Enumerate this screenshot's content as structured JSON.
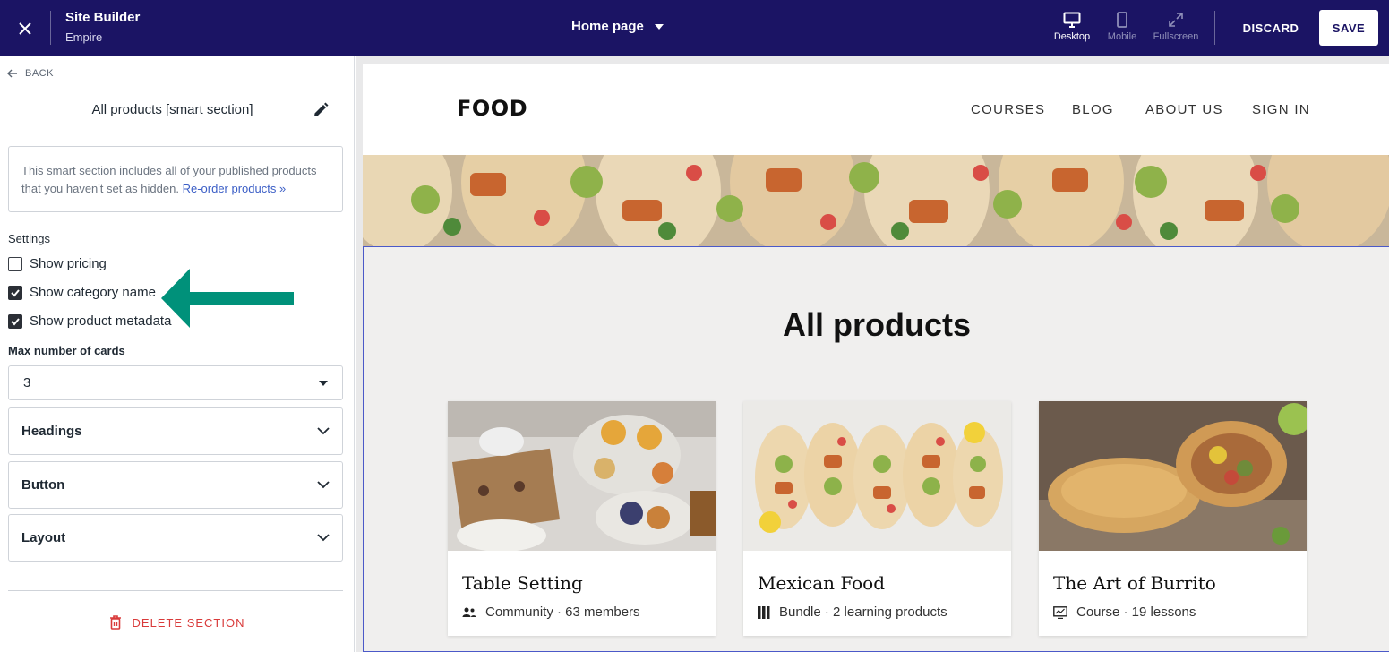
{
  "topbar": {
    "app_title": "Site Builder",
    "app_subtitle": "Empire",
    "page_select": "Home page",
    "views": [
      {
        "label": "Desktop",
        "icon": "desktop-icon",
        "active": true
      },
      {
        "label": "Mobile",
        "icon": "mobile-icon",
        "active": false
      },
      {
        "label": "Fullscreen",
        "icon": "fullscreen-icon",
        "active": false
      }
    ],
    "discard_label": "DISCARD",
    "save_label": "SAVE"
  },
  "sidebar": {
    "back_label": "BACK",
    "section_title": "All products [smart section]",
    "info_text": "This smart section includes all of your published products that you haven't set as hidden.",
    "info_link": "Re-order products »",
    "settings_label": "Settings",
    "checkboxes": [
      {
        "label": "Show pricing",
        "checked": false
      },
      {
        "label": "Show category name",
        "checked": true
      },
      {
        "label": "Show product metadata",
        "checked": true
      }
    ],
    "max_cards_label": "Max number of cards",
    "max_cards_value": "3",
    "accordions": [
      "Headings",
      "Button",
      "Layout"
    ],
    "delete_label": "DELETE SECTION",
    "annotation_arrow_color": "#00917a"
  },
  "site": {
    "logo": "FOOD",
    "nav": [
      "COURSES",
      "BLOG",
      "ABOUT US",
      "SIGN IN"
    ],
    "section_heading": "All products",
    "cards": [
      {
        "title": "Table Setting",
        "meta": "Community · 63 members",
        "icon": "community-icon"
      },
      {
        "title": "Mexican Food",
        "meta": "Bundle · 2 learning products",
        "icon": "bundle-icon"
      },
      {
        "title": "The Art of Burrito",
        "meta": "Course · 19 lessons",
        "icon": "course-icon"
      }
    ]
  },
  "colors": {
    "topbar_bg": "#1b1464",
    "accent_link": "#3b5ec6",
    "danger": "#d93a3a",
    "selection_outline": "#4b59c8"
  }
}
